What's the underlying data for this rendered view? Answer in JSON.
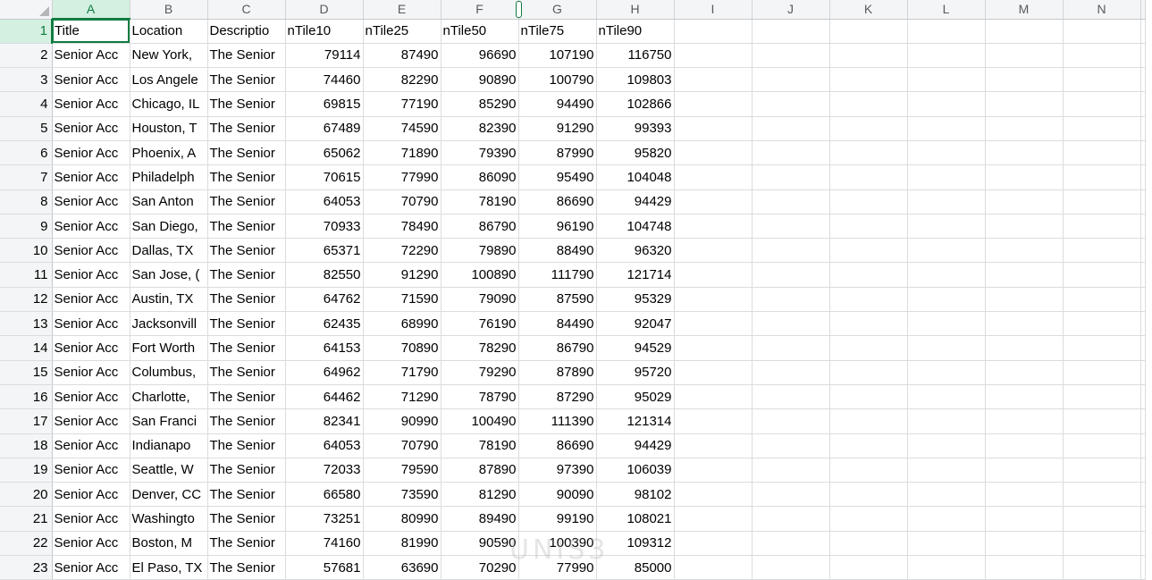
{
  "columns": [
    "A",
    "B",
    "C",
    "D",
    "E",
    "F",
    "G",
    "H",
    "I",
    "J",
    "K",
    "L",
    "M",
    "N"
  ],
  "selected_column": "A",
  "selected_row": 1,
  "header_row": [
    "Title",
    "Location",
    "Descriptio",
    "nTile10",
    "nTile25",
    "nTile50",
    "nTile75",
    "nTile90"
  ],
  "rows": [
    {
      "n": "2",
      "title": "Senior Acc",
      "location": "New York,",
      "desc": "The Senior",
      "p10": "79114",
      "p25": "87490",
      "p50": "96690",
      "p75": "107190",
      "p90": "116750"
    },
    {
      "n": "3",
      "title": "Senior Acc",
      "location": "Los Angele",
      "desc": "The Senior",
      "p10": "74460",
      "p25": "82290",
      "p50": "90890",
      "p75": "100790",
      "p90": "109803"
    },
    {
      "n": "4",
      "title": "Senior Acc",
      "location": "Chicago, IL",
      "desc": "The Senior",
      "p10": "69815",
      "p25": "77190",
      "p50": "85290",
      "p75": "94490",
      "p90": "102866"
    },
    {
      "n": "5",
      "title": "Senior Acc",
      "location": "Houston, T",
      "desc": "The Senior",
      "p10": "67489",
      "p25": "74590",
      "p50": "82390",
      "p75": "91290",
      "p90": "99393"
    },
    {
      "n": "6",
      "title": "Senior Acc",
      "location": "Phoenix, A",
      "desc": "The Senior",
      "p10": "65062",
      "p25": "71890",
      "p50": "79390",
      "p75": "87990",
      "p90": "95820"
    },
    {
      "n": "7",
      "title": "Senior Acc",
      "location": "Philadelph",
      "desc": "The Senior",
      "p10": "70615",
      "p25": "77990",
      "p50": "86090",
      "p75": "95490",
      "p90": "104048"
    },
    {
      "n": "8",
      "title": "Senior Acc",
      "location": "San Anton",
      "desc": "The Senior",
      "p10": "64053",
      "p25": "70790",
      "p50": "78190",
      "p75": "86690",
      "p90": "94429"
    },
    {
      "n": "9",
      "title": "Senior Acc",
      "location": "San Diego,",
      "desc": "The Senior",
      "p10": "70933",
      "p25": "78490",
      "p50": "86790",
      "p75": "96190",
      "p90": "104748"
    },
    {
      "n": "10",
      "title": "Senior Acc",
      "location": "Dallas, TX",
      "desc": "The Senior",
      "p10": "65371",
      "p25": "72290",
      "p50": "79890",
      "p75": "88490",
      "p90": "96320"
    },
    {
      "n": "11",
      "title": "Senior Acc",
      "location": "San Jose, (",
      "desc": "The Senior",
      "p10": "82550",
      "p25": "91290",
      "p50": "100890",
      "p75": "111790",
      "p90": "121714"
    },
    {
      "n": "12",
      "title": "Senior Acc",
      "location": "Austin, TX",
      "desc": "The Senior",
      "p10": "64762",
      "p25": "71590",
      "p50": "79090",
      "p75": "87590",
      "p90": "95329"
    },
    {
      "n": "13",
      "title": "Senior Acc",
      "location": "Jacksonvill",
      "desc": "The Senior",
      "p10": "62435",
      "p25": "68990",
      "p50": "76190",
      "p75": "84490",
      "p90": "92047"
    },
    {
      "n": "14",
      "title": "Senior Acc",
      "location": "Fort Worth",
      "desc": "The Senior",
      "p10": "64153",
      "p25": "70890",
      "p50": "78290",
      "p75": "86790",
      "p90": "94529"
    },
    {
      "n": "15",
      "title": "Senior Acc",
      "location": "Columbus,",
      "desc": "The Senior",
      "p10": "64962",
      "p25": "71790",
      "p50": "79290",
      "p75": "87890",
      "p90": "95720"
    },
    {
      "n": "16",
      "title": "Senior Acc",
      "location": "Charlotte,",
      "desc": "The Senior",
      "p10": "64462",
      "p25": "71290",
      "p50": "78790",
      "p75": "87290",
      "p90": "95029"
    },
    {
      "n": "17",
      "title": "Senior Acc",
      "location": "San Franci",
      "desc": "The Senior",
      "p10": "82341",
      "p25": "90990",
      "p50": "100490",
      "p75": "111390",
      "p90": "121314"
    },
    {
      "n": "18",
      "title": "Senior Acc",
      "location": "Indianapo",
      "desc": "The Senior",
      "p10": "64053",
      "p25": "70790",
      "p50": "78190",
      "p75": "86690",
      "p90": "94429"
    },
    {
      "n": "19",
      "title": "Senior Acc",
      "location": "Seattle, W",
      "desc": "The Senior",
      "p10": "72033",
      "p25": "79590",
      "p50": "87890",
      "p75": "97390",
      "p90": "106039"
    },
    {
      "n": "20",
      "title": "Senior Acc",
      "location": "Denver, CC",
      "desc": "The Senior",
      "p10": "66580",
      "p25": "73590",
      "p50": "81290",
      "p75": "90090",
      "p90": "98102"
    },
    {
      "n": "21",
      "title": "Senior Acc",
      "location": "Washingto",
      "desc": "The Senior",
      "p10": "73251",
      "p25": "80990",
      "p50": "89490",
      "p75": "99190",
      "p90": "108021"
    },
    {
      "n": "22",
      "title": "Senior Acc",
      "location": "Boston, M",
      "desc": "The Senior",
      "p10": "74160",
      "p25": "81990",
      "p50": "90590",
      "p75": "100390",
      "p90": "109312"
    },
    {
      "n": "23",
      "title": "Senior Acc",
      "location": "El Paso, TX",
      "desc": "The Senior",
      "p10": "57681",
      "p25": "63690",
      "p50": "70290",
      "p75": "77990",
      "p90": "85000"
    }
  ],
  "watermark": "UNIS3",
  "colors": {
    "accent": "#107c41",
    "header_bg": "#f4f5f6",
    "selected_bg": "#d3f0e0",
    "gridline": "#dadcdf"
  },
  "icons": {
    "corner": "select-all-triangle-icon",
    "resize": "column-resize-handle-icon"
  }
}
